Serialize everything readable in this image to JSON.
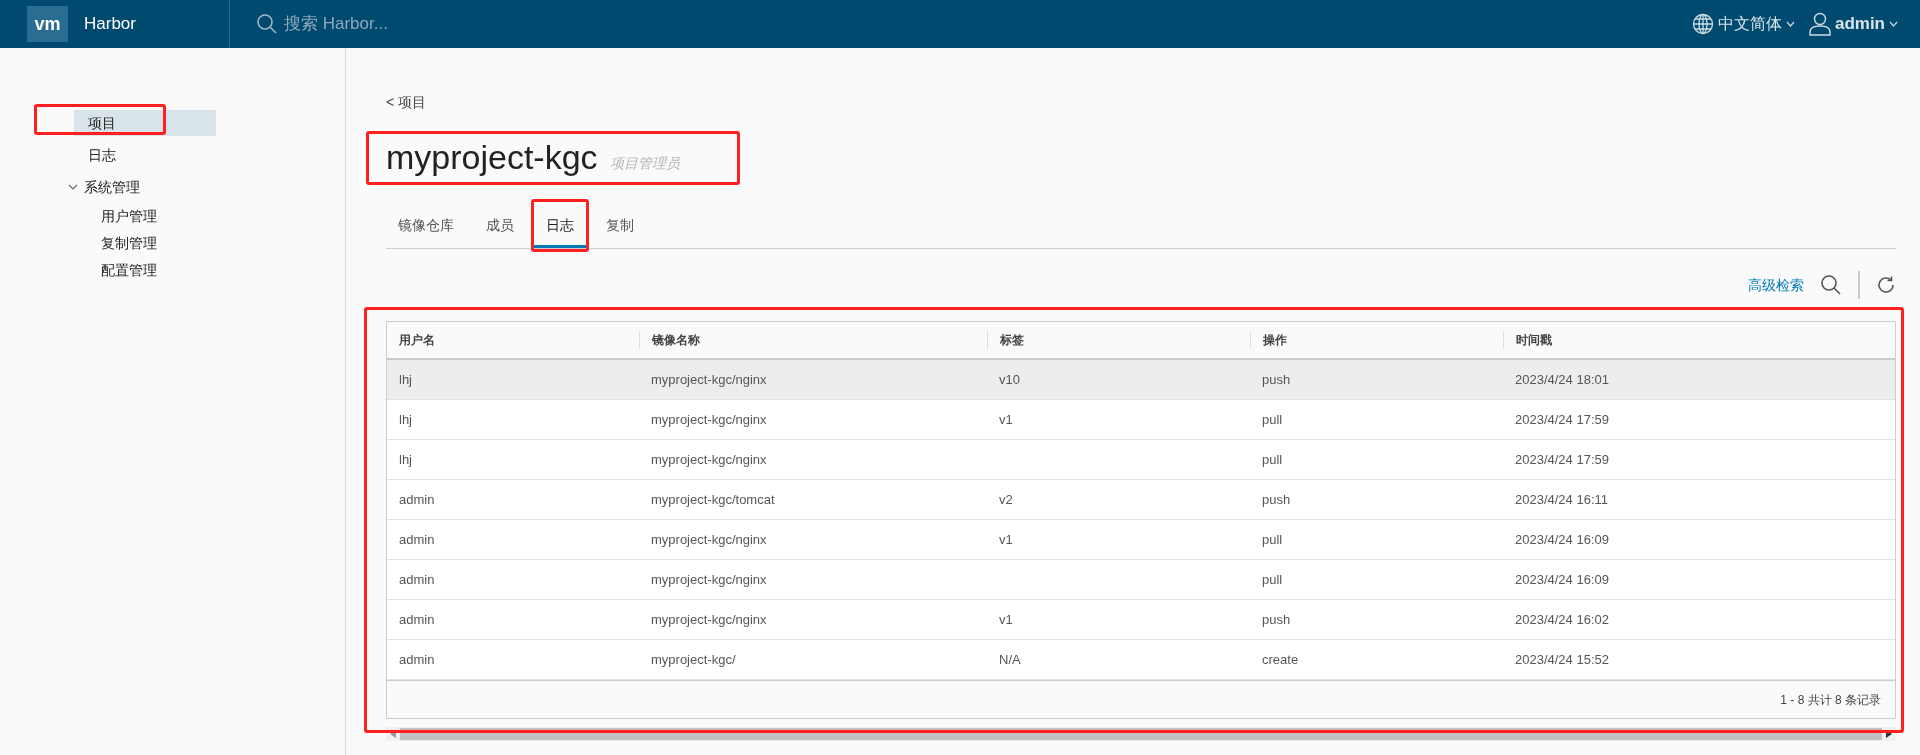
{
  "header": {
    "logo": "vm",
    "product": "Harbor",
    "search_placeholder": "搜索 Harbor...",
    "language": "中文简体",
    "user": "admin"
  },
  "sidebar": {
    "items": [
      {
        "label": "项目",
        "selected": true,
        "annotated": true
      },
      {
        "label": "日志",
        "selected": false,
        "annotated": false
      },
      {
        "label": "系统管理",
        "selected": false,
        "annotated": false,
        "expanded": true,
        "children": [
          {
            "label": "用户管理",
            "selected": false
          },
          {
            "label": "复制管理",
            "selected": false
          },
          {
            "label": "配置管理",
            "selected": false
          }
        ]
      }
    ]
  },
  "breadcrumb": "< 项目",
  "project": {
    "title": "myproject-kgc",
    "role": "项目管理员",
    "annotated": true
  },
  "tabs": [
    {
      "label": "镜像仓库",
      "selected": false,
      "annotated": false
    },
    {
      "label": "成员",
      "selected": false,
      "annotated": false
    },
    {
      "label": "日志",
      "selected": true,
      "annotated": true
    },
    {
      "label": "复制",
      "selected": false,
      "annotated": false
    }
  ],
  "toolbar": {
    "advanced_search": "高级检索"
  },
  "table": {
    "annotated": true,
    "columns": [
      "用户名",
      "镜像名称",
      "标签",
      "操作",
      "时间戳"
    ],
    "rows": [
      {
        "highlighted": true,
        "cells": [
          "lhj",
          "myproject-kgc/nginx",
          "v10",
          "push",
          "2023/4/24 18:01"
        ]
      },
      {
        "highlighted": false,
        "cells": [
          "lhj",
          "myproject-kgc/nginx",
          "v1",
          "pull",
          "2023/4/24 17:59"
        ]
      },
      {
        "highlighted": false,
        "cells": [
          "lhj",
          "myproject-kgc/nginx",
          "",
          "pull",
          "2023/4/24 17:59"
        ]
      },
      {
        "highlighted": false,
        "cells": [
          "admin",
          "myproject-kgc/tomcat",
          "v2",
          "push",
          "2023/4/24 16:11"
        ]
      },
      {
        "highlighted": false,
        "cells": [
          "admin",
          "myproject-kgc/nginx",
          "v1",
          "pull",
          "2023/4/24 16:09"
        ]
      },
      {
        "highlighted": false,
        "cells": [
          "admin",
          "myproject-kgc/nginx",
          "",
          "pull",
          "2023/4/24 16:09"
        ]
      },
      {
        "highlighted": false,
        "cells": [
          "admin",
          "myproject-kgc/nginx",
          "v1",
          "push",
          "2023/4/24 16:02"
        ]
      },
      {
        "highlighted": false,
        "cells": [
          "admin",
          "myproject-kgc/",
          "N/A",
          "create",
          "2023/4/24 15:52"
        ]
      }
    ],
    "footer": "1 - 8 共计 8 条记录"
  }
}
